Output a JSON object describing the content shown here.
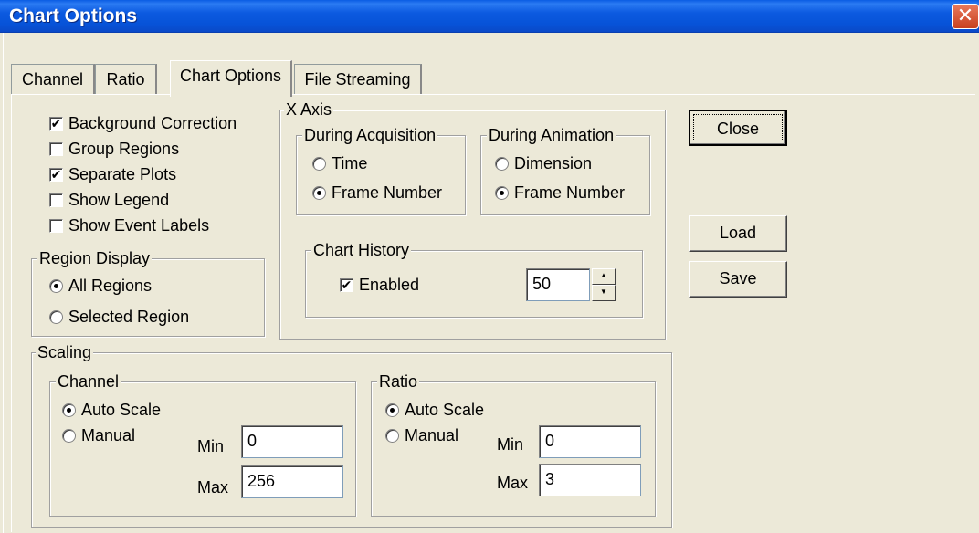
{
  "window": {
    "title": "Chart Options",
    "close_glyph": "✕"
  },
  "tabs": [
    {
      "label": "Channel"
    },
    {
      "label": "Ratio"
    },
    {
      "label": "Chart Options"
    },
    {
      "label": "File Streaming"
    }
  ],
  "options": {
    "background_correction": "Background Correction",
    "group_regions": "Group Regions",
    "separate_plots": "Separate Plots",
    "show_legend": "Show Legend",
    "show_event_labels": "Show Event Labels",
    "check_glyph": "✔"
  },
  "region_display": {
    "title": "Region Display",
    "all_regions": "All Regions",
    "selected_region": "Selected Region"
  },
  "x_axis": {
    "title": "X Axis",
    "during_acquisition": {
      "title": "During Acquisition",
      "time": "Time",
      "frame_number": "Frame Number"
    },
    "during_animation": {
      "title": "During Animation",
      "dimension": "Dimension",
      "frame_number": "Frame Number"
    },
    "chart_history": {
      "title": "Chart History",
      "enabled": "Enabled",
      "value": "50"
    }
  },
  "scaling": {
    "title": "Scaling",
    "channel": {
      "title": "Channel",
      "auto_scale": "Auto Scale",
      "manual": "Manual",
      "min_label": "Min",
      "min": "0",
      "max_label": "Max",
      "max": "256"
    },
    "ratio": {
      "title": "Ratio",
      "auto_scale": "Auto Scale",
      "manual": "Manual",
      "min_label": "Min",
      "min": "0",
      "max_label": "Max",
      "max": "3"
    }
  },
  "buttons": {
    "close": "Close",
    "load": "Load",
    "save": "Save"
  },
  "spin_glyphs": {
    "up": "▲",
    "down": "▼"
  },
  "colors": {
    "titlebar": "#0a5ce3",
    "dialog_bg": "#ece9d8",
    "close_button": "#d9542f"
  }
}
